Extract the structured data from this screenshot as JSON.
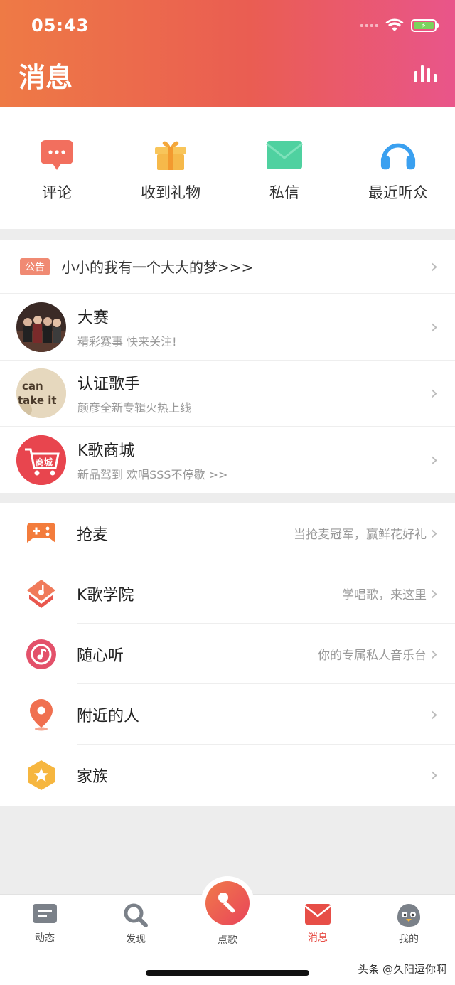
{
  "status_bar": {
    "time": "05:43"
  },
  "header": {
    "title": "消息"
  },
  "quick_actions": [
    {
      "label": "评论",
      "icon": "comment-bubble-icon",
      "color": "#f26f5e"
    },
    {
      "label": "收到礼物",
      "icon": "gift-icon",
      "color": "#f6b94a"
    },
    {
      "label": "私信",
      "icon": "envelope-icon",
      "color": "#4fd1a0"
    },
    {
      "label": "最近听众",
      "icon": "headphones-icon",
      "color": "#3aa0f0"
    }
  ],
  "notice": {
    "tag": "公告",
    "text": "小小的我有一个大大的梦>>>"
  },
  "promo_list": [
    {
      "title": "大赛",
      "subtitle": "精彩赛事 快来关注!"
    },
    {
      "title": "认证歌手",
      "subtitle": "颜彦全新专辑火热上线",
      "avatar_text_1": "can",
      "avatar_text_2": "take it"
    },
    {
      "title": "K歌商城",
      "subtitle": "新品驾到 欢唱SSS不停歇 >>",
      "avatar_text": "商城"
    }
  ],
  "feature_list": [
    {
      "title": "抢麦",
      "subtitle": "当抢麦冠军，赢鲜花好礼",
      "icon": "gamepad-icon"
    },
    {
      "title": "K歌学院",
      "subtitle": "学唱歌，来这里",
      "icon": "academy-icon"
    },
    {
      "title": "随心听",
      "subtitle": "你的专属私人音乐台",
      "icon": "music-note-icon"
    },
    {
      "title": "附近的人",
      "subtitle": "",
      "icon": "location-pin-icon"
    },
    {
      "title": "家族",
      "subtitle": "",
      "icon": "star-hexagon-icon"
    }
  ],
  "tabs": [
    {
      "label": "动态",
      "active": false
    },
    {
      "label": "发现",
      "active": false
    },
    {
      "label": "点歌",
      "active": false
    },
    {
      "label": "消息",
      "active": true
    },
    {
      "label": "我的",
      "active": false
    }
  ],
  "watermark": "头条 @久阳逗你啊",
  "colors": {
    "accent": "#e74e47",
    "header_start": "#ee7a45",
    "header_end": "#e9558a"
  }
}
